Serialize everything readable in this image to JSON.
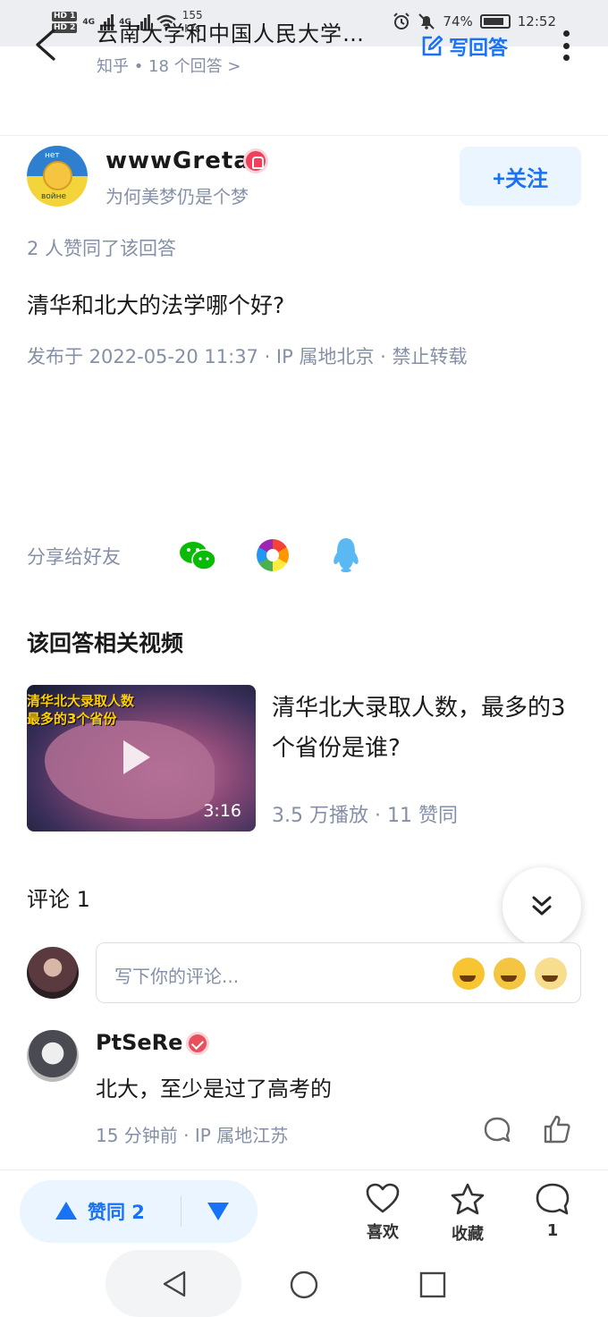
{
  "status_bar": {
    "hd1": "HD 1",
    "hd2": "HD 2",
    "net1": "4G",
    "net2": "4G",
    "speed_value": "155",
    "speed_unit": "K/s",
    "battery": "74%",
    "time": "12:52"
  },
  "header": {
    "title": "云南大学和中国人民大学…",
    "subtitle": "知乎 • 18 个回答 >",
    "write_answer": "写回答"
  },
  "author": {
    "name": "wwwGreta",
    "bio": "为何美梦仍是个梦",
    "avatar_text_top": "нет",
    "avatar_text_bottom": "войне",
    "follow_label": "+关注"
  },
  "answer": {
    "agree_count_text": "2 人赞同了该回答",
    "content": "清华和北大的法学哪个好?",
    "published": "发布于 2022-05-20 11:37 · IP 属地北京 · 禁止转载"
  },
  "share": {
    "label": "分享给好友",
    "targets": [
      "wechat-icon",
      "moments-icon",
      "qq-icon"
    ]
  },
  "related_video": {
    "section_title": "该回答相关视频",
    "thumb_caption_line1": "清华北大录取人数",
    "thumb_caption_line2": "最多的3个省份",
    "duration": "3:16",
    "title": "清华北大录取人数，最多的3个省份是谁?",
    "stats": "3.5 万播放 · 11 赞同"
  },
  "comments": {
    "title": "评论 1",
    "input_placeholder": "写下你的评论...",
    "items": [
      {
        "name": "PtSeRe",
        "text": "北大，至少是过了高考的",
        "meta": "15 分钟前 · IP 属地江苏"
      }
    ]
  },
  "action_bar": {
    "agree_label": "赞同 2",
    "like_label": "喜欢",
    "collect_label": "收藏",
    "comment_count": "1"
  },
  "colors": {
    "accent": "#1772f6",
    "muted": "#8590a6"
  }
}
